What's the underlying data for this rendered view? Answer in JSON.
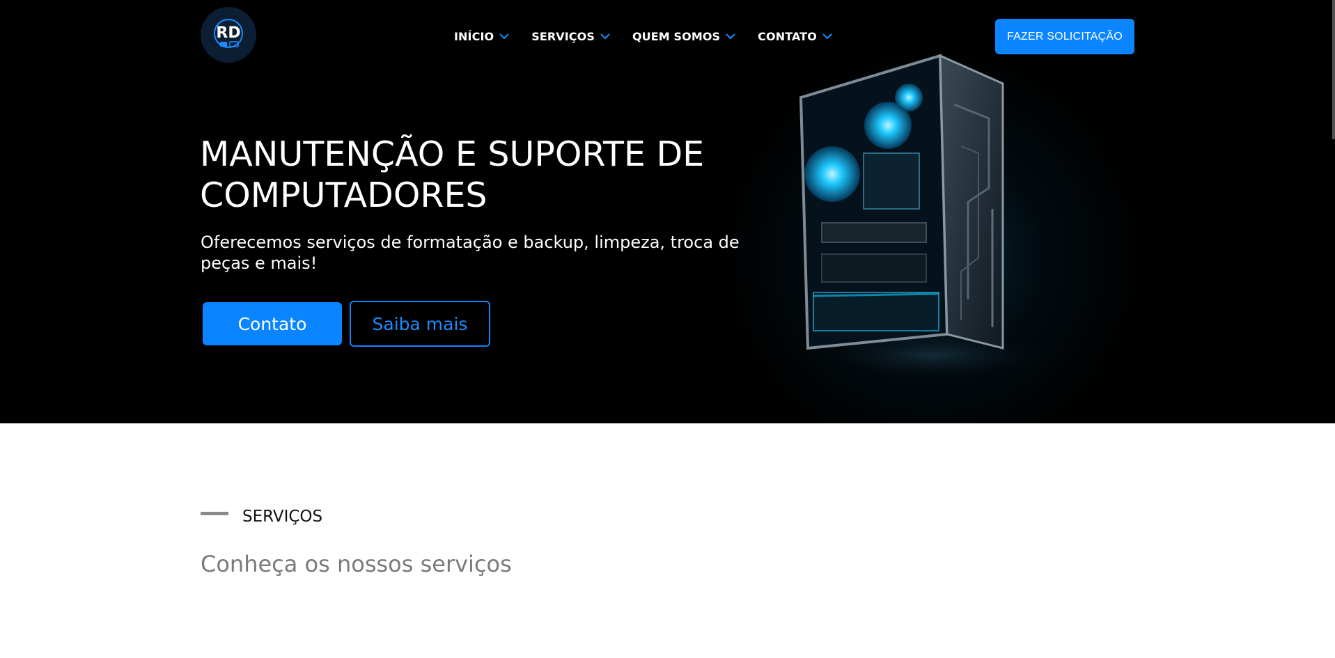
{
  "header": {
    "logo_text": "RD",
    "nav": [
      {
        "label": "INÍCIO"
      },
      {
        "label": "SERVIÇOS"
      },
      {
        "label": "QUEM SOMOS"
      },
      {
        "label": "CONTATO"
      }
    ],
    "cta_label": "FAZER SOLICITAÇÃO"
  },
  "hero": {
    "title": "MANUTENÇÃO E SUPORTE DE COMPUTADORES",
    "subtitle": "Oferecemos serviços de formatação e backup, limpeza, troca de peças e mais!",
    "primary_button": "Contato",
    "secondary_button": "Saiba mais"
  },
  "services": {
    "label": "SERVIÇOS",
    "title": "Conheça os nossos serviços"
  },
  "colors": {
    "accent": "#0a84ff",
    "hero_bg": "#000000",
    "chevron": "#1a8cff"
  },
  "icons": {
    "logo": "computer-logo-icon",
    "chevron": "chevron-down-icon"
  }
}
